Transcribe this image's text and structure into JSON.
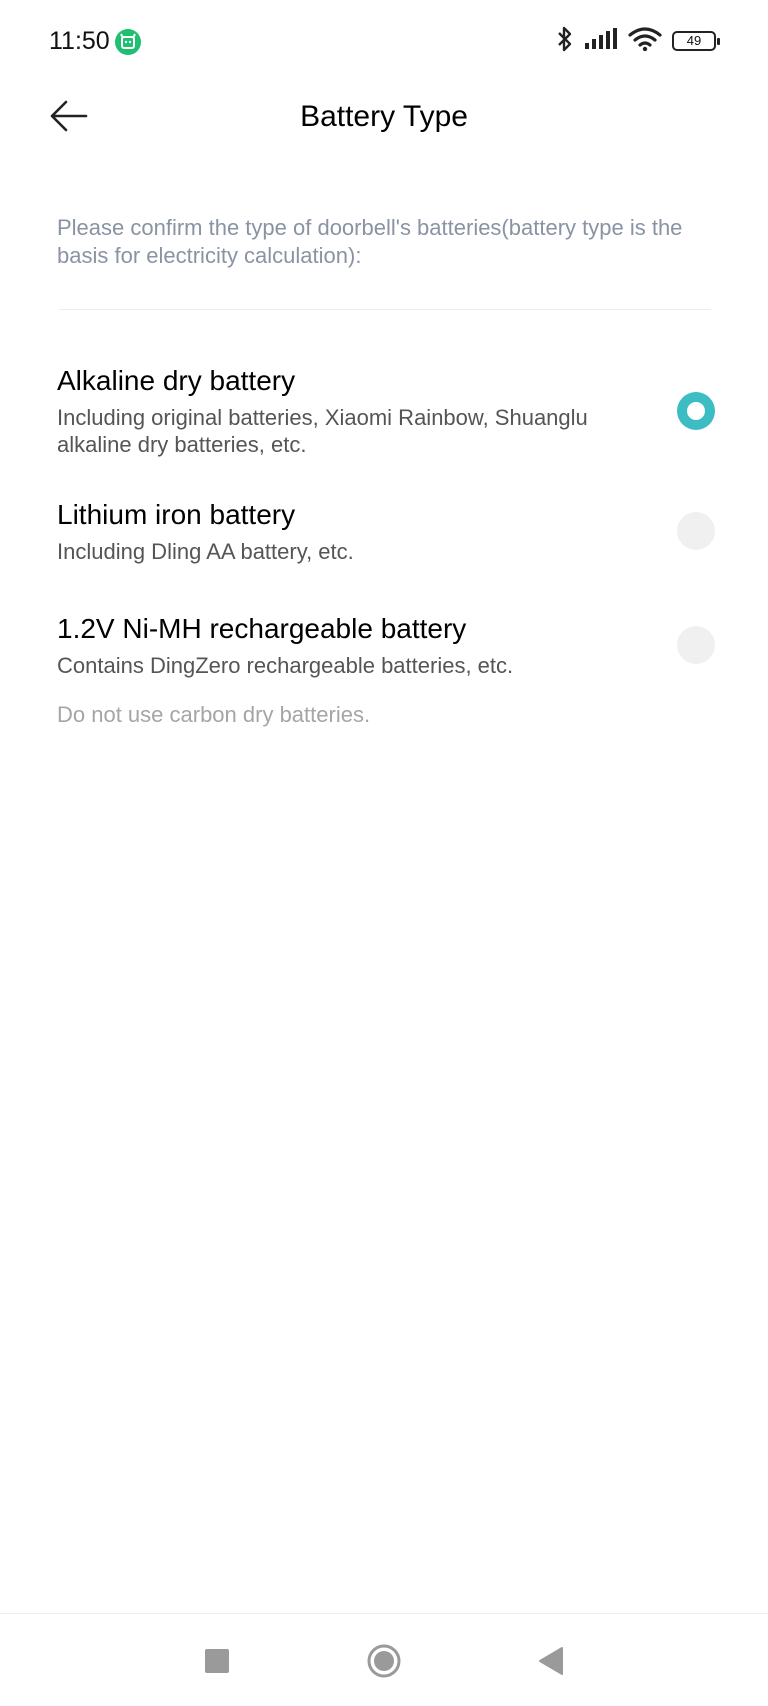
{
  "status_bar": {
    "time": "11:50",
    "battery_level": "49",
    "icons": [
      "mi-home-icon",
      "bluetooth-icon",
      "signal-icon",
      "wifi-icon",
      "battery-icon"
    ]
  },
  "header": {
    "title": "Battery Type",
    "back_icon": "arrow-left-icon"
  },
  "intro_text": "Please confirm the type of doorbell's batteries(battery type is the basis for electricity calculation):",
  "options": [
    {
      "title": "Alkaline dry battery",
      "description": "Including original batteries, Xiaomi Rainbow, Shuanglu alkaline dry batteries, etc.",
      "selected": true
    },
    {
      "title": "Lithium iron battery",
      "description": "Including Dling AA battery, etc.",
      "selected": false
    },
    {
      "title": "1.2V Ni-MH rechargeable battery",
      "description": "Contains DingZero rechargeable batteries, etc.",
      "selected": false
    }
  ],
  "note": "Do not use carbon dry batteries.",
  "colors": {
    "accent": "#3cbcc3",
    "intro_text": "#8a93a3",
    "radio_off": "#f0f0f0",
    "app_badge": "#1fbf72"
  },
  "nav_bar": {
    "buttons": [
      "recents-square-icon",
      "home-circle-icon",
      "back-triangle-icon"
    ]
  }
}
